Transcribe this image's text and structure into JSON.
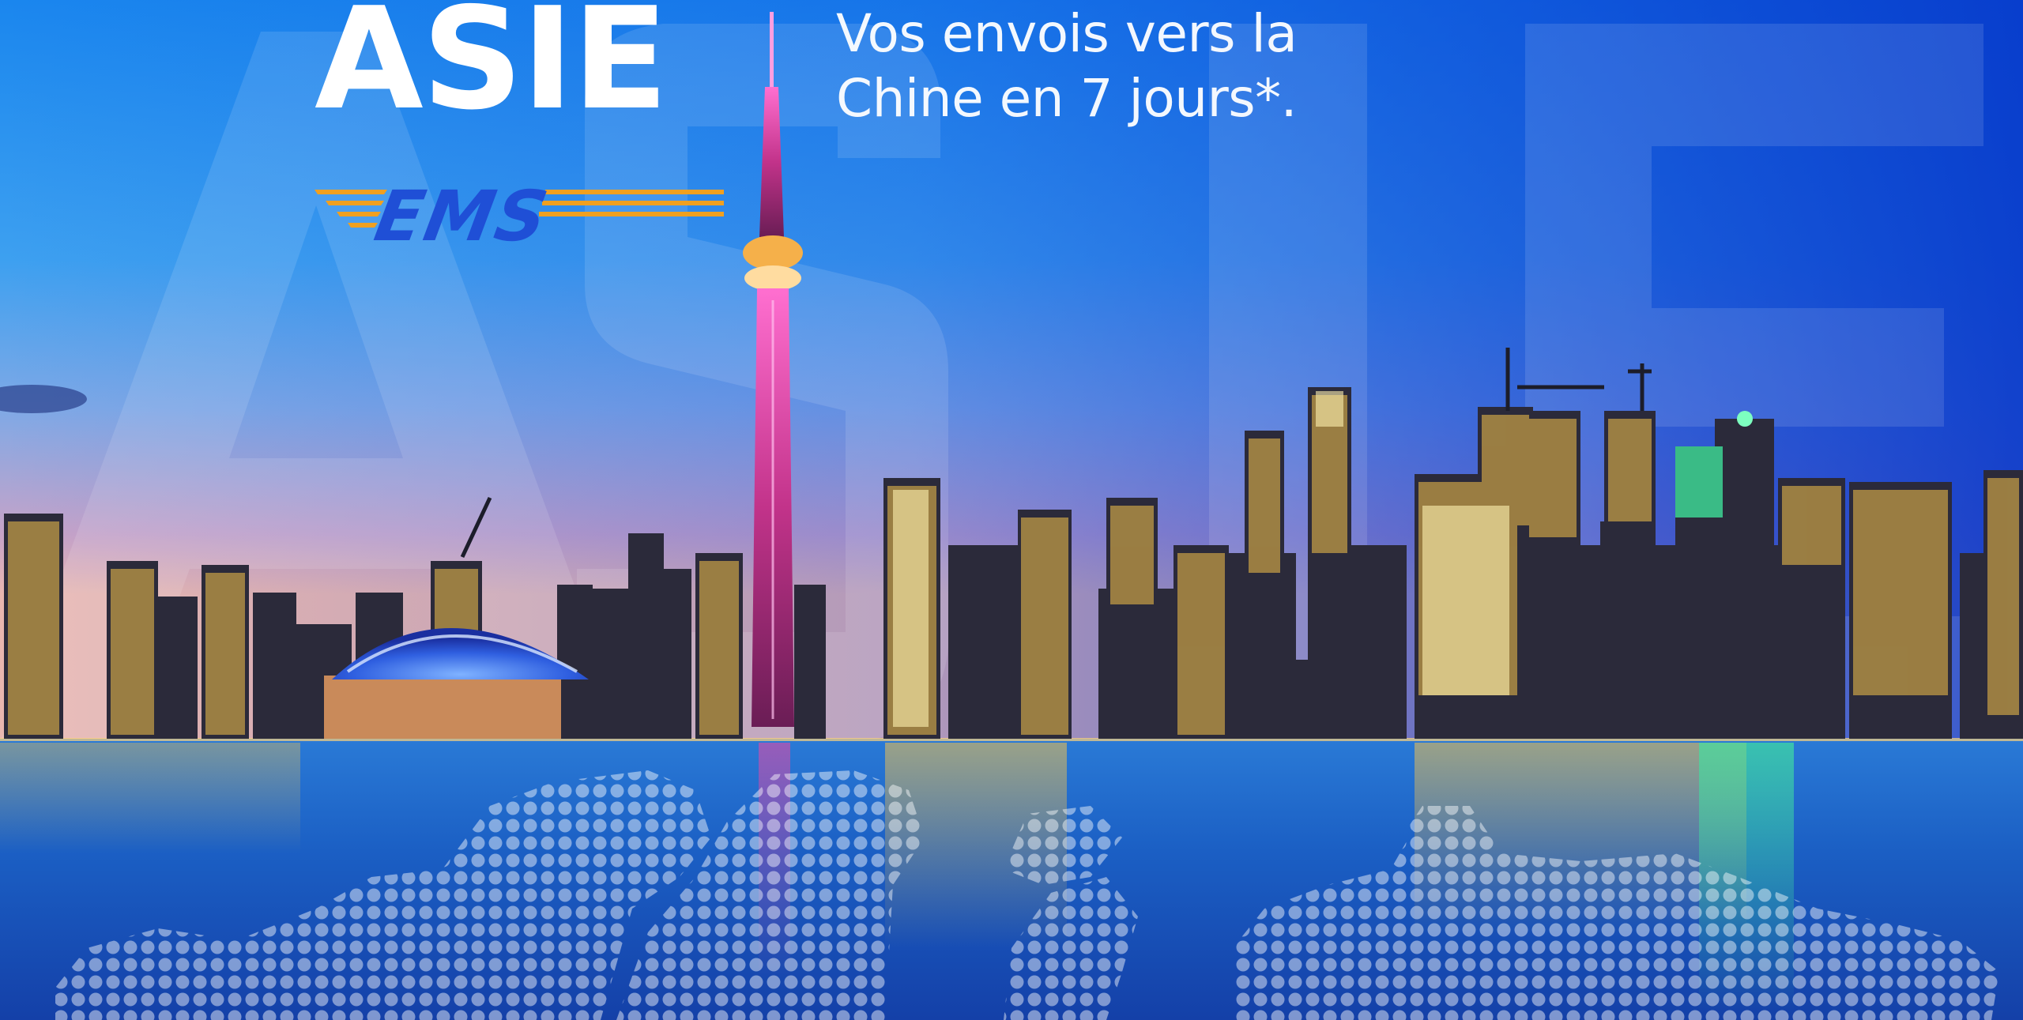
{
  "hero": {
    "title": "ASIE",
    "tagline_line1": "Vos envois vers la",
    "tagline_line2": "Chine en 7 jours*."
  },
  "logo": {
    "text": "EMS",
    "icon": "ems-logo"
  },
  "colors": {
    "sky_top": "#0b3fd8",
    "sky_mid": "#1f8fe8",
    "sky_horizon": "#c7a3c8",
    "water": "#1b63c9",
    "tower_glow": "#e04aa8",
    "city_lights": "#f5c24a",
    "ems_orange": "#f0a020",
    "ems_blue": "#1f4fd6"
  }
}
